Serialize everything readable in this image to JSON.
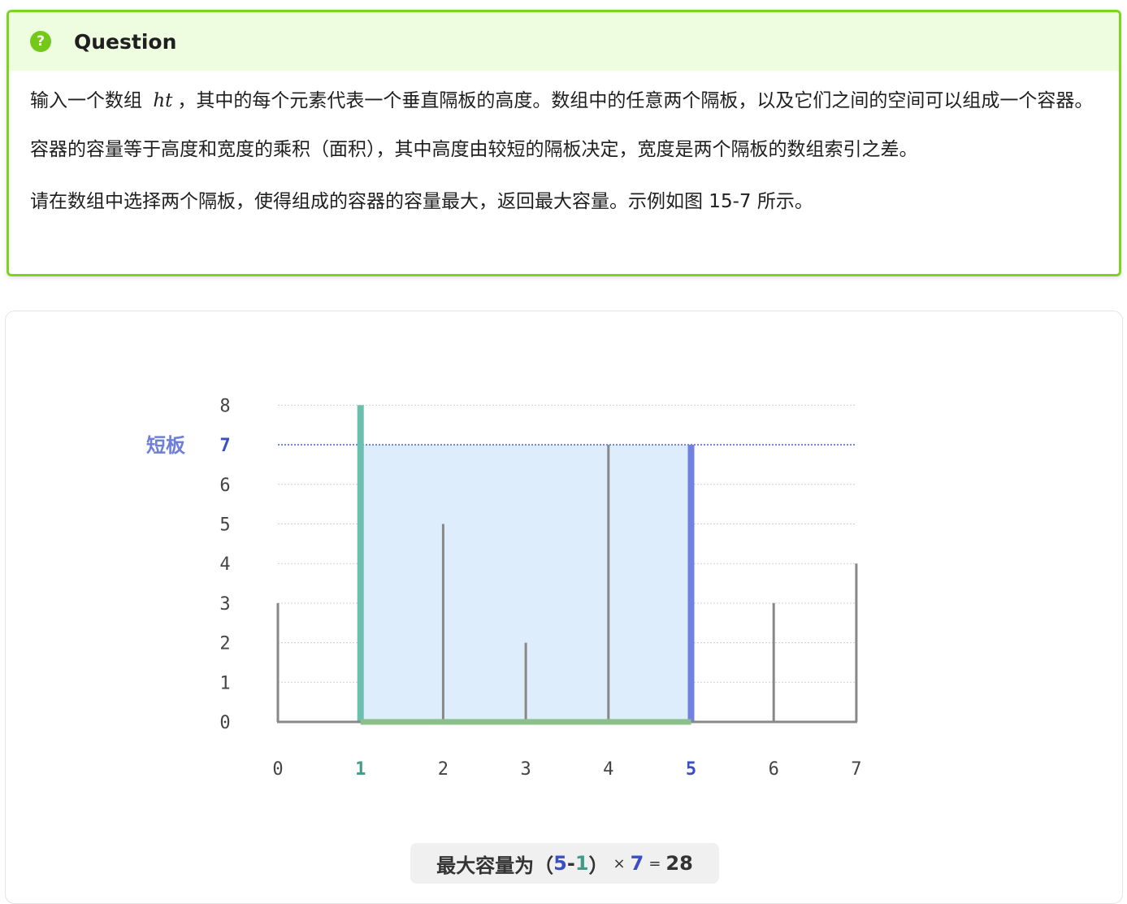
{
  "question": {
    "icon": "question-circle-icon",
    "title": "Question",
    "p1_before": "输入一个数组 ",
    "p1_var": "ht",
    "p1_after": "，其中的每个元素代表一个垂直隔板的高度。数组中的任意两个隔板，以及它们之间的空间可以组成一个容器。",
    "p2": "容器的容量等于高度和宽度的乘积（面积），其中高度由较短的隔板决定，宽度是两个隔板的数组索引之差。",
    "p3": "请在数组中选择两个隔板，使得组成的容器的容量最大，返回最大容量。示例如图 15-7 所示。",
    "accent_color": "#7ed321"
  },
  "chart_data": {
    "type": "bar",
    "categories": [
      "0",
      "1",
      "2",
      "3",
      "4",
      "5",
      "6",
      "7"
    ],
    "values": [
      3,
      8,
      5,
      2,
      7,
      7,
      3,
      4
    ],
    "y_ticks": [
      "0",
      "1",
      "2",
      "3",
      "4",
      "5",
      "6",
      "7",
      "8"
    ],
    "ylim": [
      0,
      8
    ],
    "highlight_left_index": 1,
    "highlight_right_index": 5,
    "highlight_height": 7,
    "short_board_label": "短板",
    "colors": {
      "bar": "#888888",
      "left": "#6bbfae",
      "right": "#7081e0",
      "fill": "#deedfb",
      "base": "#8cc08a",
      "label_blue": "#3b4fc4",
      "label_teal": "#3e9c89",
      "short_board": "#6d7fd8"
    }
  },
  "caption": {
    "prefix": "最大容量为",
    "open": "（",
    "a": "5",
    "minus": "-",
    "b": "1",
    "close": "）",
    "times": "×",
    "h": "7",
    "eq": "=",
    "result": "28"
  }
}
